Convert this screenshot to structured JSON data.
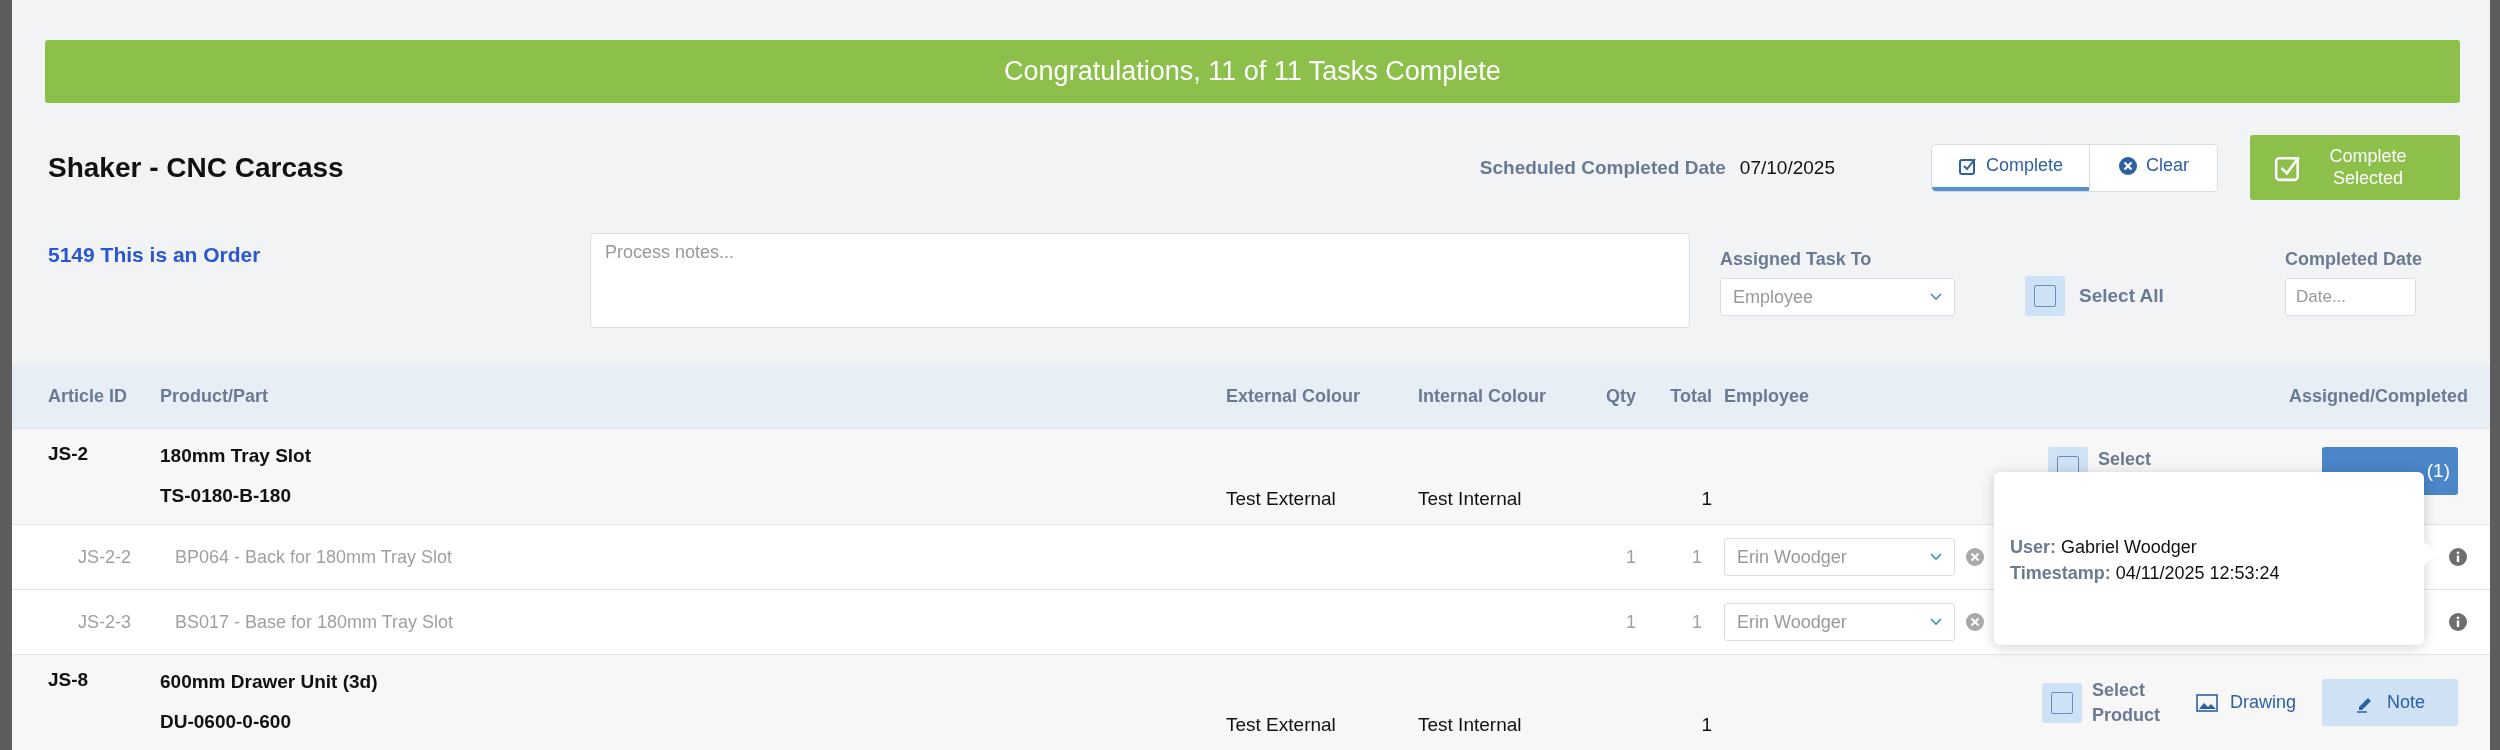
{
  "banner": {
    "text": "Congratulations, 11 of 11 Tasks Complete"
  },
  "title": "Shaker - CNC Carcass",
  "scheduled": {
    "label": "Scheduled Completed Date",
    "value": "07/10/2025"
  },
  "mode_tabs": [
    {
      "label": "Complete",
      "selected": true
    },
    {
      "label": "Clear",
      "selected": false
    }
  ],
  "complete_selected_button": {
    "label": "Complete Selected"
  },
  "order_link": "5149 This is an Order",
  "notes": {
    "placeholder": "Process notes..."
  },
  "assigned": {
    "label": "Assigned Task To",
    "placeholder": "Employee"
  },
  "select_all": {
    "label": "Select All",
    "checked": false
  },
  "completed_date": {
    "label": "Completed Date",
    "placeholder": "Date..."
  },
  "table": {
    "columns": [
      "Article ID",
      "Product/Part",
      "External Colour",
      "Internal Colour",
      "Qty",
      "Total",
      "Employee",
      "Assigned/Completed"
    ],
    "rows": [
      {
        "kind": "product",
        "article_id": "JS-2",
        "name": "180mm Tray Slot",
        "code": "TS-0180-B-180",
        "external_colour": "Test External",
        "internal_colour": "Test Internal",
        "total": "1",
        "select": {
          "label": "Select",
          "checked": false
        },
        "assigned_button": "(1)"
      },
      {
        "kind": "part",
        "article_id": "JS-2-2",
        "name": "BP064 - Back for 180mm Tray Slot",
        "qty": "1",
        "total": "1",
        "employee": "Erin Woodger"
      },
      {
        "kind": "part",
        "article_id": "JS-2-3",
        "name": "BS017 - Base for 180mm Tray Slot",
        "qty": "1",
        "total": "1",
        "employee": "Erin Woodger"
      },
      {
        "kind": "product",
        "article_id": "JS-8",
        "name": "600mm Drawer Unit (3d)",
        "code": "DU-0600-0-600",
        "external_colour": "Test External",
        "internal_colour": "Test Internal",
        "total": "1",
        "select": {
          "label": "Select Product",
          "checked": false
        },
        "drawing_link": "Drawing",
        "note_button": "Note"
      }
    ]
  },
  "popover": {
    "user_label": "User:",
    "user": "Gabriel Woodger",
    "timestamp_label": "Timestamp:",
    "timestamp": "04/11/2025 12:53:24"
  }
}
